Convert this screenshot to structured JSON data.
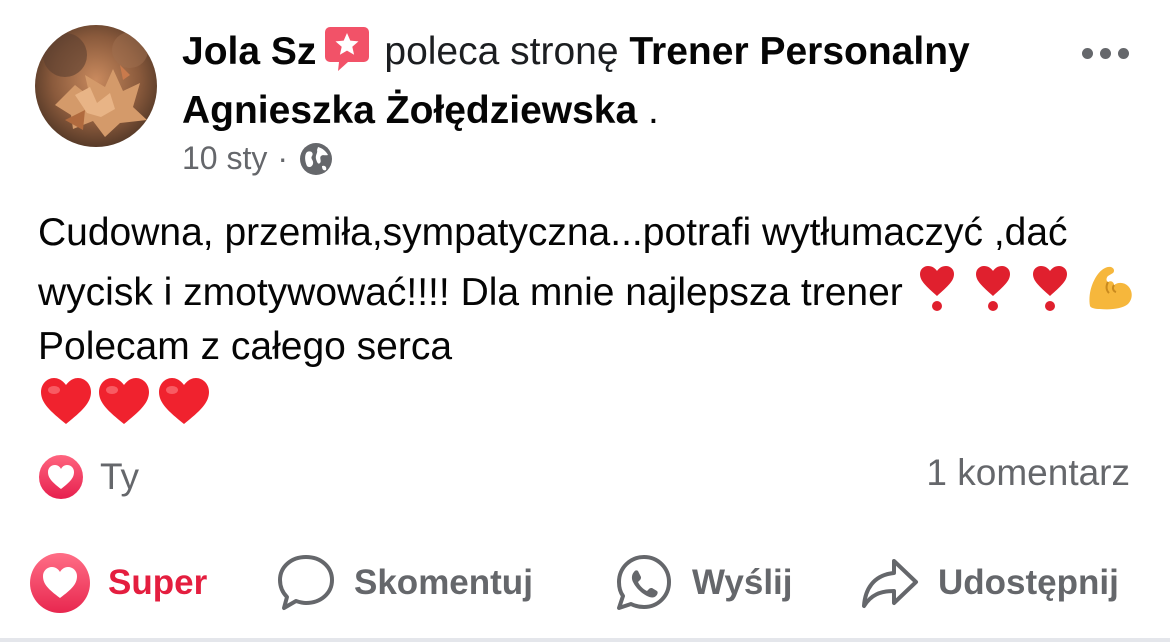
{
  "post": {
    "author": "Jola Sz",
    "verb": "poleca stronę",
    "page_name": "Trener Personalny Agnieszka Żołędziewska",
    "page_suffix": " .",
    "date": "10 sty",
    "separator": "·",
    "audience_icon": "globe-icon",
    "badge_icon": "recommendation-star-icon",
    "text_part1": "Cudowna, przemiła,sympatyczna...potrafi wytłumaczyć ,dać wycisk i zmotywować!!!! Dla mnie najlepsza trener ",
    "text_part2": " Polecam z całego serca ",
    "emoji_inline": [
      "heart-exclamation",
      "heart-exclamation",
      "heart-exclamation",
      "flexed-biceps"
    ],
    "emoji_trailing": [
      "red-heart",
      "red-heart",
      "red-heart"
    ]
  },
  "reactions": {
    "icon": "heart-reaction-icon",
    "label": "Ty"
  },
  "comments": {
    "count_label": "1 komentarz"
  },
  "actions": {
    "super_label": "Super",
    "comment_label": "Skomentuj",
    "send_label": "Wyślij",
    "share_label": "Udostępnij"
  },
  "colors": {
    "super_red": "#e41e3f",
    "heart_pink": "#f33e58",
    "secondary_text": "#65676b",
    "badge_pink": "#f25268"
  }
}
